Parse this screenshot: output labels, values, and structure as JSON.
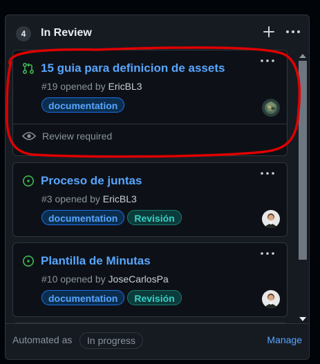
{
  "column": {
    "count": "4",
    "title": "In Review"
  },
  "cards": [
    {
      "status_icon": "pull-request-icon",
      "status_color": "#3fb950",
      "title": "15 guia para definicion de assets",
      "number": "#19",
      "opened_by_text": "opened by",
      "author": "EricBL3",
      "labels": [
        "documentation"
      ],
      "review_status": "Review required"
    },
    {
      "status_icon": "issue-open-icon",
      "status_color": "#3fb950",
      "title": "Proceso de juntas",
      "number": "#3",
      "opened_by_text": "opened by",
      "author": "EricBL3",
      "labels": [
        "documentation",
        "Revisión"
      ]
    },
    {
      "status_icon": "issue-open-icon",
      "status_color": "#3fb950",
      "title": "Plantilla de Minutas",
      "number": "#10",
      "opened_by_text": "opened by",
      "author": "JoseCarlosPa",
      "labels": [
        "documentation",
        "Revisión"
      ]
    }
  ],
  "footer": {
    "automated_as": "Automated as",
    "automation_status": "In progress",
    "manage_label": "Manage"
  },
  "colors": {
    "link": "#58a6ff",
    "open_green": "#3fb950",
    "annotation_red": "#e00000"
  }
}
